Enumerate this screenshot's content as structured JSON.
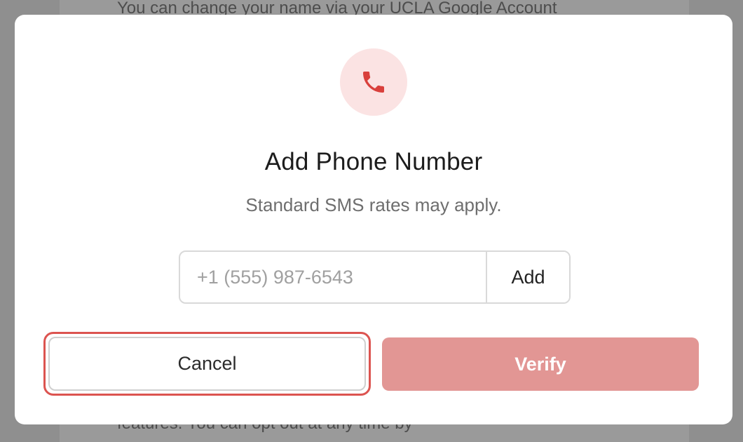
{
  "background": {
    "text_top": "You can change your name via your UCLA Google Account",
    "text_bottom": "features. You can opt out at any time by"
  },
  "modal": {
    "icon": "phone-icon",
    "title": "Add Phone Number",
    "subtitle": "Standard SMS rates may apply.",
    "phone_input": {
      "value": "",
      "placeholder": "+1 (555) 987-6543"
    },
    "add_label": "Add",
    "cancel_label": "Cancel",
    "verify_label": "Verify"
  },
  "colors": {
    "accent": "#dc5450",
    "icon_background": "#fbe3e3",
    "verify_disabled": "#e29694"
  }
}
